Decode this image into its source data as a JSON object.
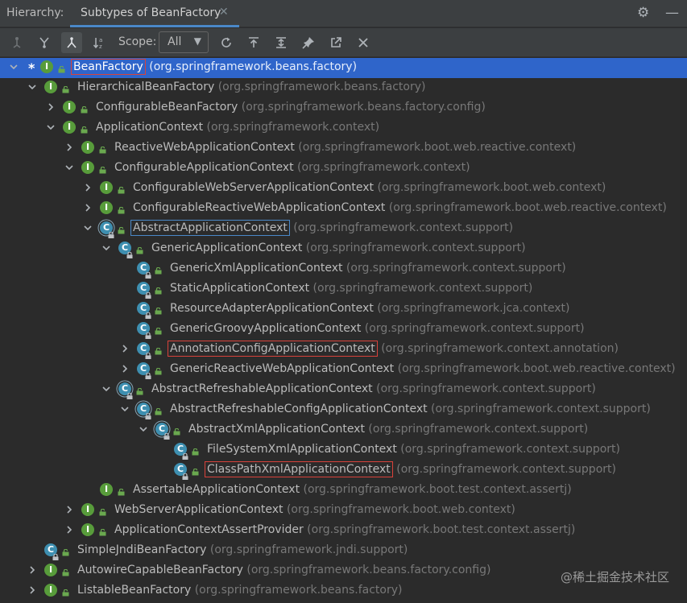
{
  "header": {
    "title": "Hierarchy:",
    "tab_label": "Subtypes of BeanFactory",
    "settings_icon": "gear-icon",
    "minimize_icon": "minimize-icon"
  },
  "toolbar": {
    "scope_label": "Scope:",
    "scope_value": "All",
    "buttons": [
      "type-hierarchy-icon",
      "supertypes-icon",
      "subtypes-icon",
      "sort-alpha-icon",
      "refresh-icon",
      "export-icon",
      "expand-all-icon",
      "pin-icon",
      "open-in-new-icon",
      "close-icon"
    ]
  },
  "tree": {
    "rows": [
      {
        "name": "BeanFactory",
        "pkg": "(org.springframework.beans.factory)"
      },
      {
        "name": "HierarchicalBeanFactory",
        "pkg": "(org.springframework.beans.factory)"
      },
      {
        "name": "ConfigurableBeanFactory",
        "pkg": "(org.springframework.beans.factory.config)"
      },
      {
        "name": "ApplicationContext",
        "pkg": "(org.springframework.context)"
      },
      {
        "name": "ReactiveWebApplicationContext",
        "pkg": "(org.springframework.boot.web.reactive.context)"
      },
      {
        "name": "ConfigurableApplicationContext",
        "pkg": "(org.springframework.context)"
      },
      {
        "name": "ConfigurableWebServerApplicationContext",
        "pkg": "(org.springframework.boot.web.context)"
      },
      {
        "name": "ConfigurableReactiveWebApplicationContext",
        "pkg": "(org.springframework.boot.web.reactive.context)"
      },
      {
        "name": "AbstractApplicationContext",
        "pkg": "(org.springframework.context.support)"
      },
      {
        "name": "GenericApplicationContext",
        "pkg": "(org.springframework.context.support)"
      },
      {
        "name": "GenericXmlApplicationContext",
        "pkg": "(org.springframework.context.support)"
      },
      {
        "name": "StaticApplicationContext",
        "pkg": "(org.springframework.context.support)"
      },
      {
        "name": "ResourceAdapterApplicationContext",
        "pkg": "(org.springframework.jca.context)"
      },
      {
        "name": "GenericGroovyApplicationContext",
        "pkg": "(org.springframework.context.support)"
      },
      {
        "name": "AnnotationConfigApplicationContext",
        "pkg": "(org.springframework.context.annotation)"
      },
      {
        "name": "GenericReactiveWebApplicationContext",
        "pkg": "(org.springframework.boot.web.reactive.context)"
      },
      {
        "name": "AbstractRefreshableApplicationContext",
        "pkg": "(org.springframework.context.support)"
      },
      {
        "name": "AbstractRefreshableConfigApplicationContext",
        "pkg": "(org.springframework.context.support)"
      },
      {
        "name": "AbstractXmlApplicationContext",
        "pkg": "(org.springframework.context.support)"
      },
      {
        "name": "FileSystemXmlApplicationContext",
        "pkg": "(org.springframework.context.support)"
      },
      {
        "name": "ClassPathXmlApplicationContext",
        "pkg": "(org.springframework.context.support)"
      },
      {
        "name": "AssertableApplicationContext",
        "pkg": "(org.springframework.boot.test.context.assertj)"
      },
      {
        "name": "WebServerApplicationContext",
        "pkg": "(org.springframework.boot.web.context)"
      },
      {
        "name": "ApplicationContextAssertProvider",
        "pkg": "(org.springframework.boot.test.context.assertj)"
      },
      {
        "name": "SimpleJndiBeanFactory",
        "pkg": "(org.springframework.jndi.support)"
      },
      {
        "name": "AutowireCapableBeanFactory",
        "pkg": "(org.springframework.beans.factory.config)"
      },
      {
        "name": "ListableBeanFactory",
        "pkg": "(org.springframework.beans.factory)"
      }
    ],
    "icon_letters": {
      "interface": "I",
      "class": "C"
    },
    "root_marker": "*"
  },
  "watermark": "@稀土掘金技术社区",
  "colors": {
    "selection": "#2f65ca",
    "interface_icon": "#589c3b",
    "class_icon": "#3e8fb0",
    "highlight_red": "#d9423b",
    "highlight_blue": "#4a88c7"
  }
}
